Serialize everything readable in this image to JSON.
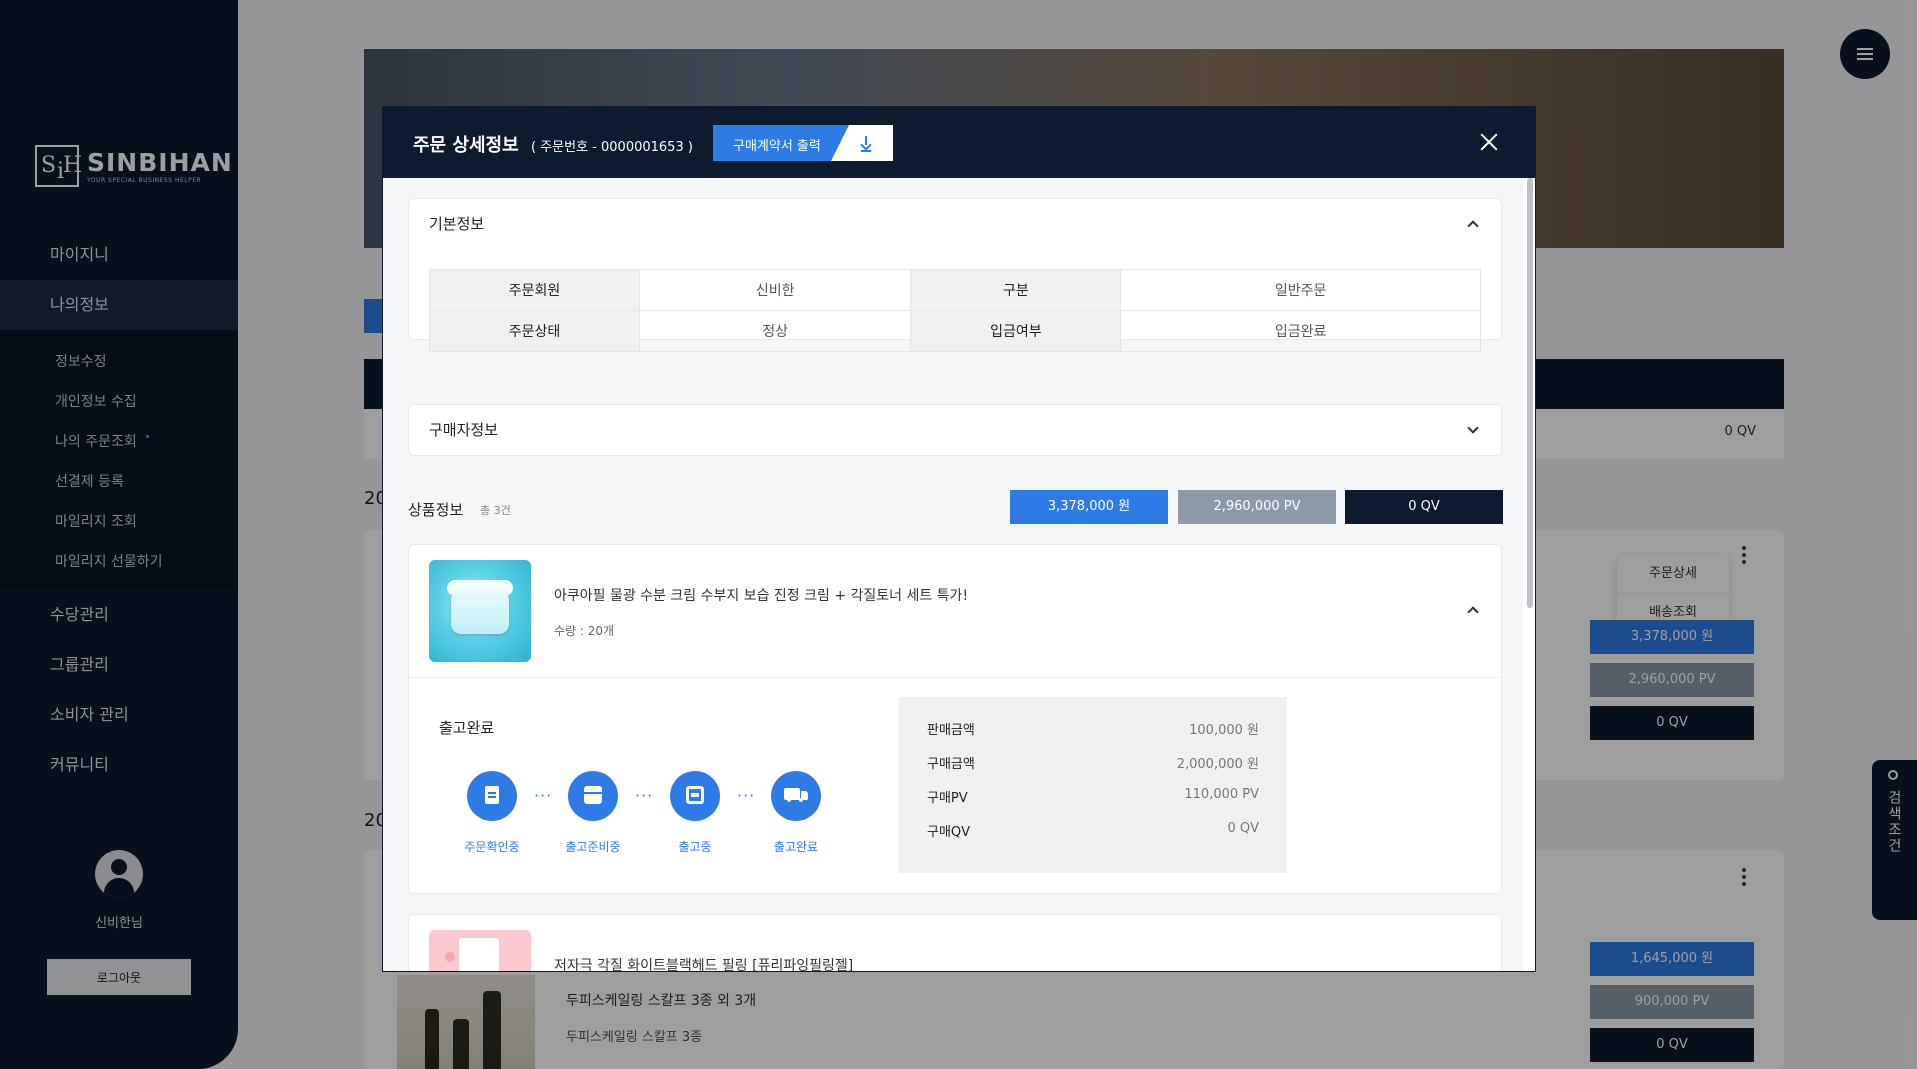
{
  "brand": {
    "name": "SINBIHAN",
    "tagline": "YOUR SPECIAL BUSINESS HELPER"
  },
  "sidebar": {
    "items": [
      {
        "label": "마이지니"
      },
      {
        "label": "나의정보"
      },
      {
        "label": "수당관리"
      },
      {
        "label": "그룹관리"
      },
      {
        "label": "소비자 관리"
      },
      {
        "label": "커뮤니티"
      }
    ],
    "sub_items": [
      {
        "label": "정보수정"
      },
      {
        "label": "개인정보 수집"
      },
      {
        "label": "나의 주문조회"
      },
      {
        "label": "선결제 등록"
      },
      {
        "label": "마일리지 조회"
      },
      {
        "label": "마일리지 선물하기"
      }
    ],
    "user_name": "신비한님",
    "logout_label": "로그아웃"
  },
  "background": {
    "row_qv": "0 QV",
    "year_1": "20",
    "year_2": "20",
    "context_menu": [
      "주문상세",
      "배송조회"
    ],
    "order1_pills": [
      "3,378,000 원",
      "2,960,000 PV",
      "0 QV"
    ],
    "order2_pills": [
      "1,645,000 원",
      "900,000 PV",
      "0 QV"
    ],
    "order2_product": "두피스케일링 스칼프 3종 외 3개",
    "order2_product_sub": "두피스케일링 스칼프 3종"
  },
  "search_tab": {
    "label": "검색조건"
  },
  "modal": {
    "title": "주문 상세정보",
    "order_no": "( 주문번호 - 0000001653 )",
    "contract_button": "구매계약서 출력",
    "basic_info": {
      "title": "기본정보",
      "rows": [
        [
          "주문회원",
          "신비한",
          "구분",
          "일반주문"
        ],
        [
          "주문상태",
          "정상",
          "입금여부",
          "입금완료"
        ]
      ]
    },
    "buyer_info": {
      "title": "구매자정보"
    },
    "product_info": {
      "title": "상품정보",
      "count": "총 3건",
      "totals": [
        "3,378,000 원",
        "2,960,000 PV",
        "0 QV"
      ]
    },
    "product1": {
      "name": "아쿠아필 물광 수분 크림 수부지 보습 진정 크림 + 각질토너 세트 특가!",
      "quantity": "수량 : 20개",
      "ship_status": "출고완료",
      "steps": [
        "주문확인중",
        "출고준비중",
        "출고중",
        "출고완료"
      ],
      "prices": [
        {
          "key": "판매금액",
          "value": "100,000 원"
        },
        {
          "key": "구매금액",
          "value": "2,000,000 원"
        },
        {
          "key": "구매PV",
          "value": "110,000 PV"
        },
        {
          "key": "구매QV",
          "value": "0 QV"
        }
      ]
    },
    "product2": {
      "name": "저자극 각질 화이트블랙헤드 필링 [퓨리파잉필링젤]"
    }
  },
  "colors": {
    "navy": "#0e1a2e",
    "blue": "#2e7be6",
    "gray_pill": "#8c99a8"
  }
}
